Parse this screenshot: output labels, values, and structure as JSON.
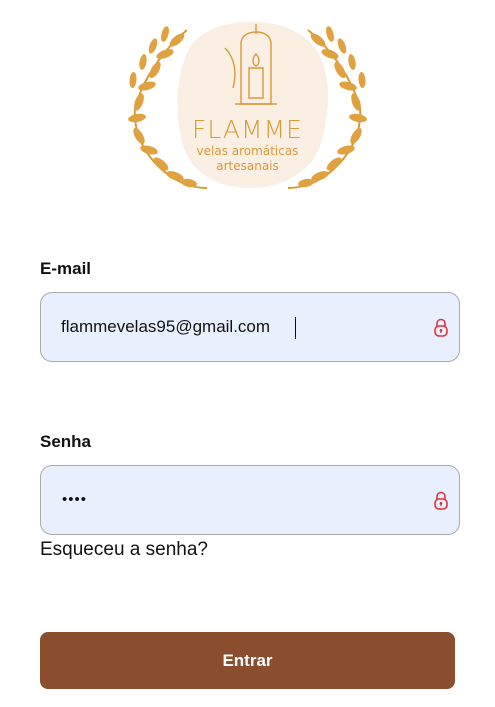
{
  "brand": {
    "name": "FLAMME",
    "tagline_line1": "velas aromáticas",
    "tagline_line2": "artesanais",
    "accent_color": "#d79a3a",
    "logo_icon": "candle-lantern-icon"
  },
  "form": {
    "email": {
      "label": "E-mail",
      "value": "flammevelas95@gmail.com",
      "icon": "lock-icon"
    },
    "password": {
      "label": "Senha",
      "masked_value": "••••",
      "icon": "lock-icon"
    },
    "forgot_link": "Esqueceu a senha?",
    "submit_label": "Entrar",
    "submit_color": "#8a4e2e",
    "field_background": "#e8effd",
    "icon_color": "#e0303c"
  }
}
